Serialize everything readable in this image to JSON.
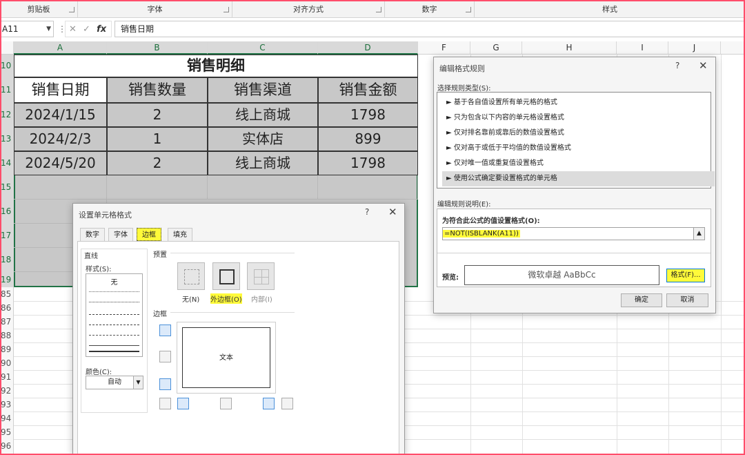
{
  "ribbon": {
    "groups": [
      "剪贴板",
      "字体",
      "对齐方式",
      "数字",
      "样式"
    ]
  },
  "formula_bar": {
    "name_box": "A11",
    "fx_label": "fx",
    "content": "销售日期"
  },
  "columns": [
    "A",
    "B",
    "C",
    "D",
    "F",
    "G",
    "H",
    "I",
    "J"
  ],
  "rows": [
    "10",
    "11",
    "12",
    "13",
    "14",
    "15",
    "16",
    "17",
    "18",
    "19",
    "85",
    "86",
    "87",
    "88",
    "89",
    "90",
    "91",
    "92",
    "93",
    "94",
    "95",
    "96"
  ],
  "sheet": {
    "title": "销售明细",
    "headers": [
      "销售日期",
      "销售数量",
      "销售渠道",
      "销售金额"
    ],
    "data": [
      [
        "2024/1/15",
        "2",
        "线上商城",
        "1798"
      ],
      [
        "2024/2/3",
        "1",
        "实体店",
        "899"
      ],
      [
        "2024/5/20",
        "2",
        "线上商城",
        "1798"
      ]
    ]
  },
  "rule_dialog": {
    "title": "编辑格式规则",
    "help": "?",
    "close": "✕",
    "select_type_label": "选择规则类型(S):",
    "rule_types": [
      "► 基于各自值设置所有单元格的格式",
      "► 只为包含以下内容的单元格设置格式",
      "► 仅对排名靠前或靠后的数值设置格式",
      "► 仅对高于或低于平均值的数值设置格式",
      "► 仅对唯一值或重复值设置格式",
      "► 使用公式确定要设置格式的单元格"
    ],
    "edit_desc_label": "编辑规则说明(E):",
    "formula_label": "为符合此公式的值设置格式(O):",
    "formula": "=NOT(ISBLANK(A11))",
    "preview_label": "预览:",
    "preview_text": "微软卓越  AaBbCc",
    "format_button": "格式(F)...",
    "ok_button": "确定",
    "cancel_button": "取消"
  },
  "format_dialog": {
    "title": "设置单元格格式",
    "help": "?",
    "close": "✕",
    "tabs": [
      "数字",
      "字体",
      "边框",
      "填充"
    ],
    "line_label": "直线",
    "style_label": "样式(S):",
    "style_none": "无",
    "color_label": "颜色(C):",
    "color_value": "自动",
    "presets_label": "预置",
    "preset_none": "无(N)",
    "preset_outline": "外边框(O)",
    "preset_inside": "内部(I)",
    "border_label": "边框",
    "preview_text": "文本"
  },
  "colors": {
    "accent_green": "#217346",
    "highlight_yellow": "#fffa3a",
    "selection_gray": "#c8c8c8"
  }
}
